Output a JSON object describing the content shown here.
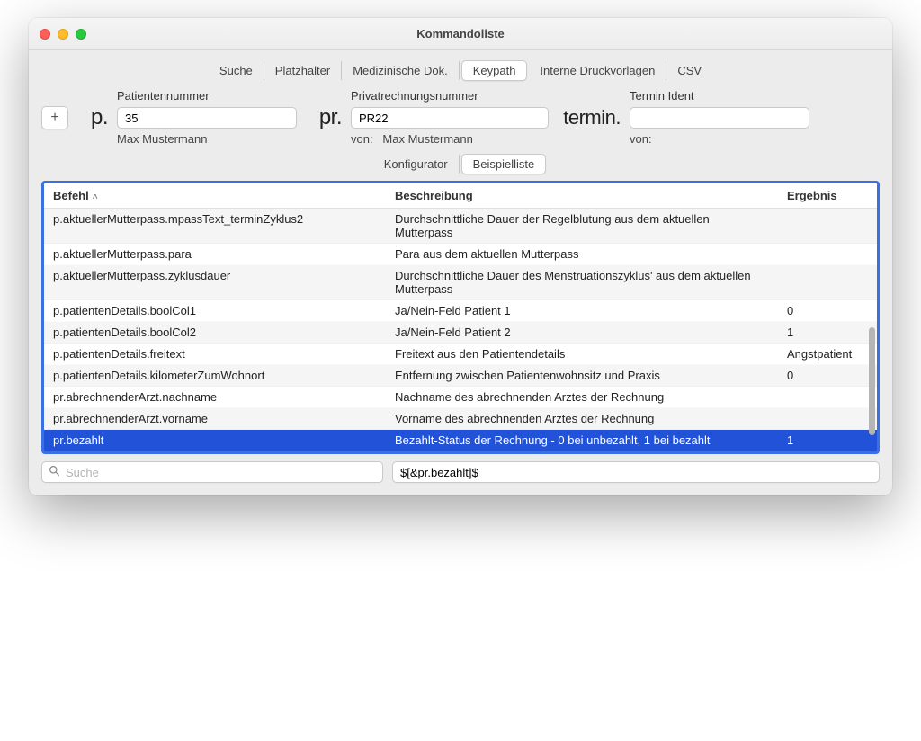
{
  "window": {
    "title": "Kommandoliste"
  },
  "tabs": {
    "items": [
      {
        "label": "Suche"
      },
      {
        "label": "Platzhalter"
      },
      {
        "label": "Medizinische Dok."
      },
      {
        "label": "Keypath",
        "active": true
      },
      {
        "label": "Interne Druckvorlagen"
      },
      {
        "label": "CSV"
      }
    ]
  },
  "form": {
    "plus_symbol": "+",
    "patient": {
      "label": "Patientennummer",
      "prefix": "p.",
      "value": "35",
      "sub": "Max Mustermann"
    },
    "invoice": {
      "label": "Privatrechnungsnummer",
      "prefix": "pr.",
      "value": "PR22",
      "sub_prefix": "von:",
      "sub": "Max Mustermann"
    },
    "termin": {
      "label": "Termin Ident",
      "prefix": "termin.",
      "value": "",
      "sub_prefix": "von:",
      "sub": ""
    }
  },
  "subtabs": {
    "items": [
      {
        "label": "Konfigurator"
      },
      {
        "label": "Beispielliste",
        "active": true
      }
    ]
  },
  "table": {
    "headers": {
      "befehl": "Befehl",
      "beschreibung": "Beschreibung",
      "ergebnis": "Ergebnis"
    },
    "rows": [
      {
        "befehl": "p.aktuellerMutterpass.mpassText_terminZyklus2",
        "beschreibung": "Durchschnittliche Dauer der Regelblutung aus dem aktuellen Mutterpass",
        "ergebnis": ""
      },
      {
        "befehl": "p.aktuellerMutterpass.para",
        "beschreibung": "Para aus dem aktuellen Mutterpass",
        "ergebnis": ""
      },
      {
        "befehl": "p.aktuellerMutterpass.zyklusdauer",
        "beschreibung": "Durchschnittliche Dauer des Menstruationszyklus' aus dem aktuellen Mutterpass",
        "ergebnis": ""
      },
      {
        "befehl": "p.patientenDetails.boolCol1",
        "beschreibung": "Ja/Nein-Feld Patient 1",
        "ergebnis": "0"
      },
      {
        "befehl": "p.patientenDetails.boolCol2",
        "beschreibung": "Ja/Nein-Feld Patient 2",
        "ergebnis": "1"
      },
      {
        "befehl": "p.patientenDetails.freitext",
        "beschreibung": "Freitext aus den Patientendetails",
        "ergebnis": "Angstpatient"
      },
      {
        "befehl": "p.patientenDetails.kilometerZumWohnort",
        "beschreibung": "Entfernung zwischen Patientenwohnsitz und Praxis",
        "ergebnis": "0"
      },
      {
        "befehl": "pr.abrechnenderArzt.nachname",
        "beschreibung": "Nachname des abrechnenden Arztes der Rechnung",
        "ergebnis": ""
      },
      {
        "befehl": "pr.abrechnenderArzt.vorname",
        "beschreibung": "Vorname des abrechnenden Arztes der Rechnung",
        "ergebnis": ""
      },
      {
        "befehl": "pr.bezahlt",
        "beschreibung": "Bezahlt-Status der Rechnung - 0 bei unbezahlt, 1 bei bezahlt",
        "ergebnis": "1",
        "selected": true
      }
    ]
  },
  "search": {
    "placeholder": "Suche",
    "value": ""
  },
  "result_field": {
    "value": "$[&pr.bezahlt]$"
  }
}
